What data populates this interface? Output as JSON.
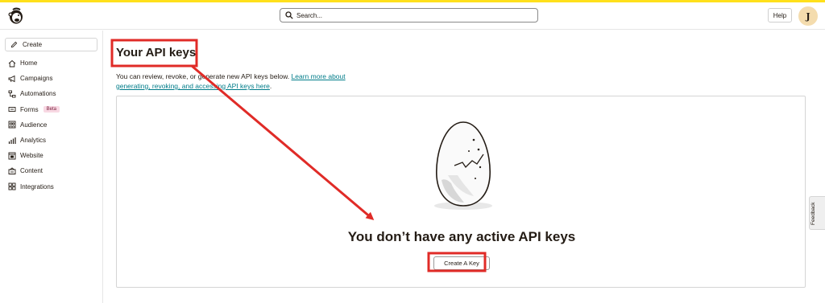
{
  "header": {
    "search_placeholder": "Search...",
    "help_label": "Help",
    "avatar_initial": "J"
  },
  "sidebar": {
    "create_label": "Create",
    "items": [
      {
        "label": "Home",
        "icon": "home-icon"
      },
      {
        "label": "Campaigns",
        "icon": "megaphone-icon"
      },
      {
        "label": "Automations",
        "icon": "automations-icon"
      },
      {
        "label": "Forms",
        "icon": "forms-icon",
        "badge": "Beta"
      },
      {
        "label": "Audience",
        "icon": "audience-icon"
      },
      {
        "label": "Analytics",
        "icon": "analytics-icon"
      },
      {
        "label": "Website",
        "icon": "website-icon"
      },
      {
        "label": "Content",
        "icon": "content-icon"
      },
      {
        "label": "Integrations",
        "icon": "integrations-icon"
      }
    ]
  },
  "main": {
    "title": "Your API keys",
    "description_prefix": "You can review, revoke, or generate new API keys below. ",
    "description_link": "Learn more about generating, revoking, and accessing API keys here",
    "description_suffix": ".",
    "empty_state_title": "You don’t have any active API keys",
    "create_key_label": "Create A Key"
  },
  "feedback_label": "Feedback",
  "colors": {
    "brand_yellow": "#ffe01b",
    "link": "#007c89",
    "annotation_red": "#e02b27",
    "text": "#241c15"
  }
}
